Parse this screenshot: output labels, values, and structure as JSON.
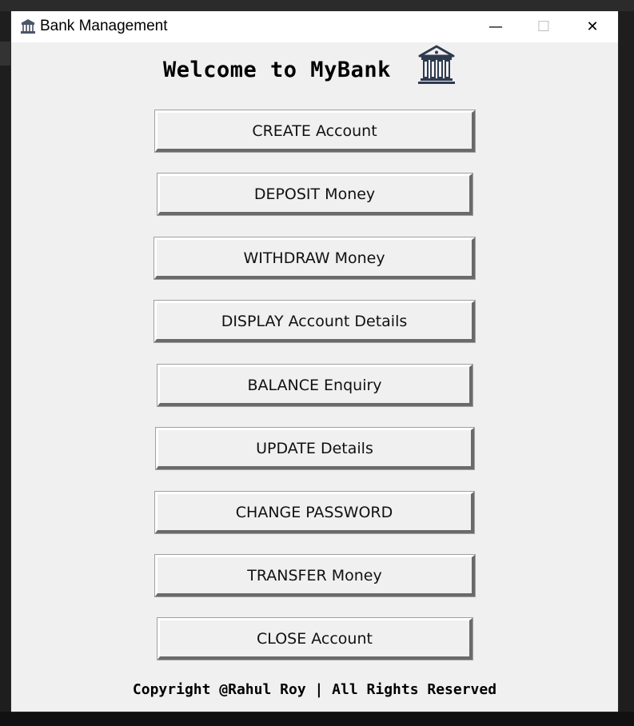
{
  "window": {
    "title": "Bank Management",
    "minimize_symbol": "—",
    "maximize_symbol": "☐",
    "close_symbol": "✕"
  },
  "heading": "Welcome to MyBank",
  "icons": {
    "title": "bank-icon",
    "heading": "bank-building-icon"
  },
  "buttons": [
    "CREATE Account",
    "DEPOSIT Money",
    "WITHDRAW Money",
    "DISPLAY Account Details",
    "BALANCE Enquiry",
    "UPDATE Details",
    "CHANGE PASSWORD",
    "TRANSFER Money",
    "CLOSE Account"
  ],
  "footer": "Copyright @Rahul Roy | All Rights Reserved",
  "colors": {
    "window_bg": "#f0f0f0",
    "titlebar_bg": "#ffffff",
    "terminal_bg": "#1e1e1e",
    "terminal_green": "#33d633",
    "bank_icon": "#2e3a4e"
  }
}
